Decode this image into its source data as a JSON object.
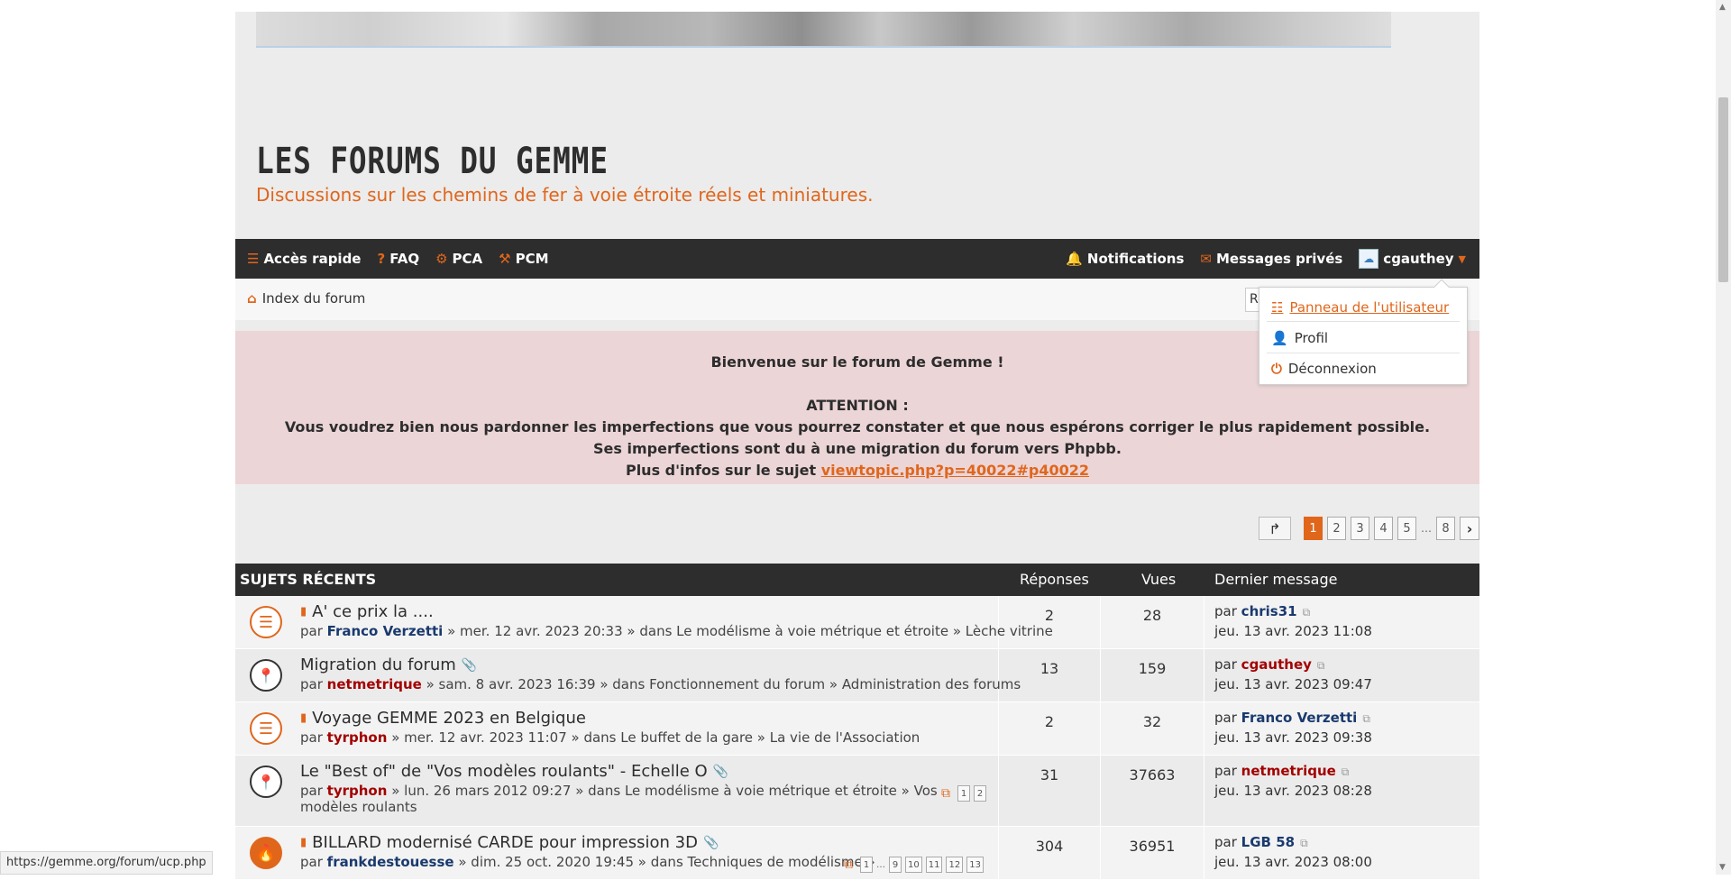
{
  "header": {
    "site_title": "LES FORUMS DU GEMME",
    "site_description": "Discussions sur les chemins de fer à voie étroite réels et miniatures."
  },
  "navbar": {
    "quick_access": "Accès rapide",
    "faq": "FAQ",
    "pca": "PCA",
    "pcm": "PCM",
    "notifications": "Notifications",
    "private_messages": "Messages privés",
    "username": "cgauthey"
  },
  "breadcrumb": {
    "home": "Index du forum",
    "search_value": "Re"
  },
  "user_menu": {
    "items": [
      {
        "label": "Panneau de l'utilisateur",
        "icon": "sliders-icon"
      },
      {
        "label": "Profil",
        "icon": "user-icon"
      },
      {
        "label": "Déconnexion",
        "icon": "power-icon"
      }
    ]
  },
  "notice": {
    "welcome": "Bienvenue sur le forum de Gemme !",
    "attention": "ATTENTION :",
    "line1": "Vous voudrez bien nous pardonner les imperfections que vous pourrez constater et que nous espérons corriger le plus rapidement possible.",
    "line2": "Ses imperfections sont du à une migration du forum vers Phpbb.",
    "line3_prefix": "Plus d'infos sur le sujet",
    "line3_link": "viewtopic.php?p=40022#p40022"
  },
  "pagination": {
    "pages": [
      "1",
      "2",
      "3",
      "4",
      "5",
      "…",
      "8"
    ],
    "active": "1"
  },
  "topics": {
    "header": {
      "title": "SUJETS RÉCENTS",
      "replies": "Réponses",
      "views": "Vues",
      "last": "Dernier message"
    },
    "rows": [
      {
        "title": "A' ce prix la ....",
        "by": "par",
        "author": "Franco Verzetti",
        "meta": "» mer. 12 avr. 2023 20:33 » dans Le modélisme à voie métrique et étroite » Lèche vitrine",
        "replies": "2",
        "views": "28",
        "last_by": "par",
        "last_author": "chris31",
        "last_date": "jeu. 13 avr. 2023 11:08"
      },
      {
        "title": "Migration du forum",
        "by": "par",
        "author": "netmetrique",
        "meta": "» sam. 8 avr. 2023 16:39 » dans Fonctionnement du forum » Administration des forums",
        "replies": "13",
        "views": "159",
        "last_by": "par",
        "last_author": "cgauthey",
        "last_date": "jeu. 13 avr. 2023 09:47"
      },
      {
        "title": "Voyage GEMME 2023 en Belgique",
        "by": "par",
        "author": "tyrphon",
        "meta": "» mer. 12 avr. 2023 11:07 » dans Le buffet de la gare » La vie de l'Association",
        "replies": "2",
        "views": "32",
        "last_by": "par",
        "last_author": "Franco Verzetti",
        "last_date": "jeu. 13 avr. 2023 09:38"
      },
      {
        "title": "Le \"Best of\" de \"Vos modèles roulants\" - Echelle O",
        "by": "par",
        "author": "tyrphon",
        "meta": "» lun. 26 mars 2012 09:27 » dans Le modélisme à voie métrique et étroite » Vos",
        "meta2": "modèles roulants",
        "mini_pages": [
          "1",
          "2"
        ],
        "replies": "31",
        "views": "37663",
        "last_by": "par",
        "last_author": "netmetrique",
        "last_date": "jeu. 13 avr. 2023 08:28"
      },
      {
        "title": "BILLARD modernisé CARDE pour impression 3D",
        "by": "par",
        "author": "frankdestouesse",
        "meta": "» dim. 25 oct. 2020 19:45 » dans Techniques de modélisme »",
        "mini_pages": [
          "1",
          "…",
          "9",
          "10",
          "11",
          "12",
          "13"
        ],
        "replies": "304",
        "views": "36951",
        "last_by": "par",
        "last_author": "LGB 58",
        "last_date": "jeu. 13 avr. 2023 08:00"
      }
    ]
  },
  "status_url": "https://gemme.org/forum/ucp.php",
  "colors": {
    "accent": "#e0661c",
    "nav_bg": "#2d2d2d",
    "notice_bg": "#ecd5d7"
  }
}
